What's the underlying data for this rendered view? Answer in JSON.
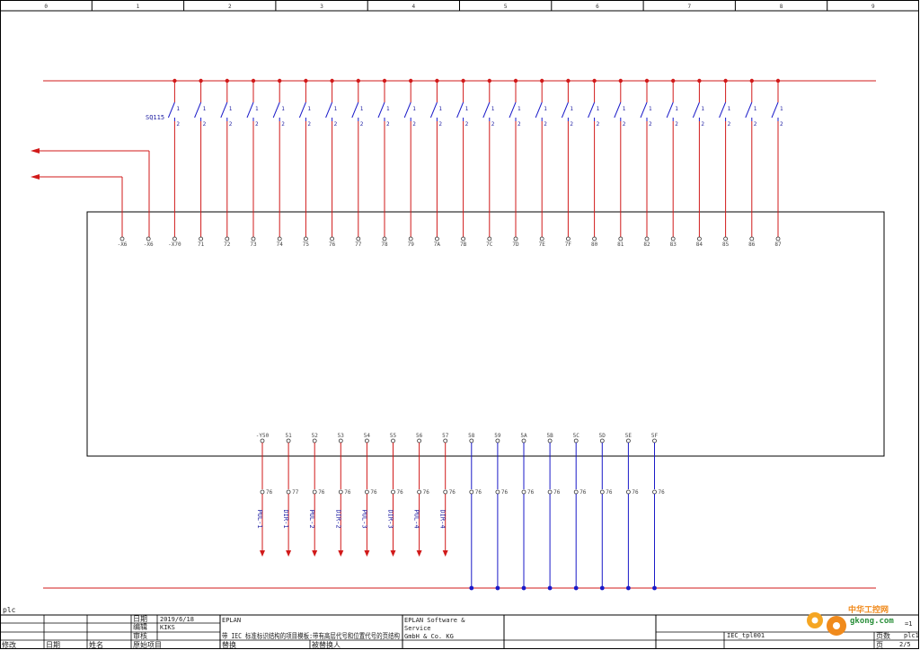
{
  "sheet": {
    "zones": [
      "0",
      "1",
      "2",
      "3",
      "4",
      "5",
      "6",
      "7",
      "8",
      "9"
    ],
    "corner_label": "plc"
  },
  "schematic": {
    "switch_device_tag": "SQ115",
    "switch_count": 24,
    "switch_contact_top": "1",
    "switch_contact_bottom": "2",
    "top_terminals": [
      "-X6",
      "-X6",
      "-X70",
      "71",
      "72",
      "73",
      "74",
      "75",
      "76",
      "77",
      "78",
      "79",
      "7A",
      "7B",
      "7C",
      "7D",
      "7E",
      "7F",
      "80",
      "81",
      "82",
      "83",
      "84",
      "85",
      "86",
      "87"
    ],
    "bottom_terminals": [
      "-Y50",
      "51",
      "52",
      "53",
      "54",
      "55",
      "56",
      "57",
      "58",
      "59",
      "5A",
      "5B",
      "5C",
      "5D",
      "5E",
      "5F"
    ],
    "bottom_wire_labels": [
      "76",
      "77",
      "76",
      "76",
      "76",
      "76",
      "76",
      "76",
      "76",
      "76",
      "76",
      "76",
      "76",
      "76",
      "76",
      "76"
    ],
    "signal_labels": [
      "PUL-1",
      "DIR-1",
      "PUL-2",
      "DIR-2",
      "PUL-3",
      "DIR-3",
      "PUL-4",
      "DIR-4"
    ],
    "colors": {
      "red": "#d11a1a",
      "blue": "#1a1ac8",
      "frame": "#000000"
    }
  },
  "title_block": {
    "date_label": "日期",
    "date_value": "2019/6/18",
    "drawn_label": "编辑",
    "drawn_value": "KIKS",
    "checked_label": "审核",
    "company": "EPLAN",
    "description": "带 IEC 标准标识结构的项目模板:带有高层代号和位置代号的页结构",
    "vendor_line1": "EPLAN Software &",
    "vendor_line2": "Service",
    "vendor_line3": "GmbH & Co. KG",
    "bottom_labels": [
      "修改",
      "日期",
      "姓名",
      "原始项目",
      "替换",
      "被替换人"
    ],
    "drawing_no": "IEC_tpl001",
    "sheet_label": "页",
    "sheet_value": "2/5",
    "pages_label": "页数",
    "pages_value": "plc1",
    "sheet_tag": "=1"
  },
  "watermark": {
    "brand": "中华工控网",
    "domain": "gkong.com"
  }
}
